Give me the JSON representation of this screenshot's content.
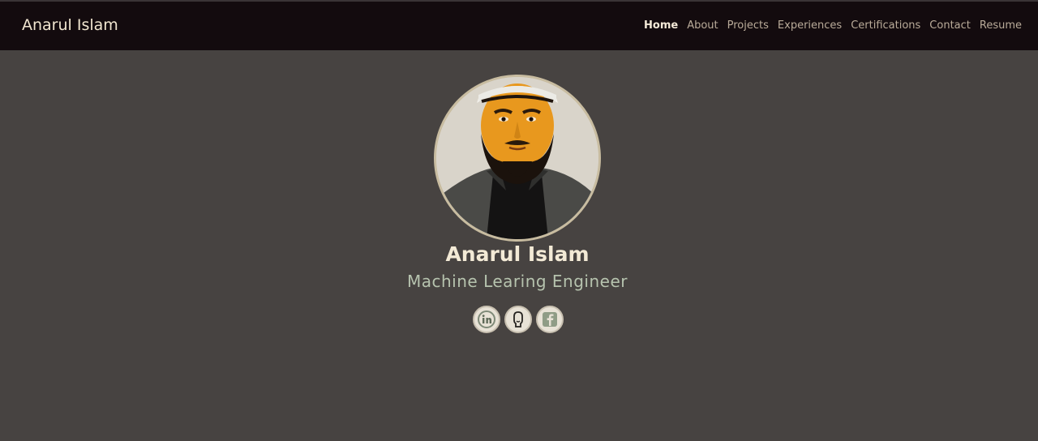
{
  "nav": {
    "brand": "Anarul Islam",
    "links": [
      {
        "label": "Home",
        "active": true
      },
      {
        "label": "About"
      },
      {
        "label": "Projects"
      },
      {
        "label": "Experiences"
      },
      {
        "label": "Certifications"
      },
      {
        "label": "Contact"
      },
      {
        "label": "Resume"
      }
    ]
  },
  "hero": {
    "name": "Anarul Islam",
    "title": "Machine Learing Engineer",
    "socials": [
      {
        "icon": "linkedin-icon"
      },
      {
        "icon": "github-icon"
      },
      {
        "icon": "facebook-icon"
      }
    ]
  },
  "colors": {
    "navbar_bg": "#130b0e",
    "page_bg": "#474341",
    "name_color": "#f3ead6",
    "title_color": "#b6c3ae"
  }
}
